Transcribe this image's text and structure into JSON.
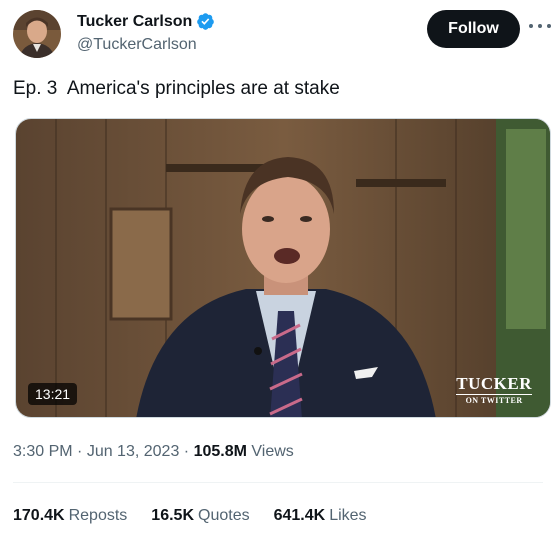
{
  "author": {
    "display_name": "Tucker Carlson",
    "handle": "@TuckerCarlson",
    "verified_color": "#1d9bf0"
  },
  "follow_label": "Follow",
  "tweet": {
    "text": "Ep. 3  America's principles are at stake"
  },
  "media": {
    "duration": "13:21",
    "watermark_main": "TUCKER",
    "watermark_sub": "ON TWITTER"
  },
  "meta": {
    "time": "3:30 PM",
    "sep1": " · ",
    "date": "Jun 13, 2023",
    "sep2": " · ",
    "views_count": "105.8M",
    "views_label": " Views"
  },
  "stats": [
    {
      "count": "170.4K",
      "label": "Reposts"
    },
    {
      "count": "16.5K",
      "label": "Quotes"
    },
    {
      "count": "641.4K",
      "label": "Likes"
    }
  ],
  "colors": {
    "text_primary": "#0f1419",
    "text_secondary": "#536471",
    "follow_bg": "#0f1419",
    "divider": "#eff3f4"
  }
}
